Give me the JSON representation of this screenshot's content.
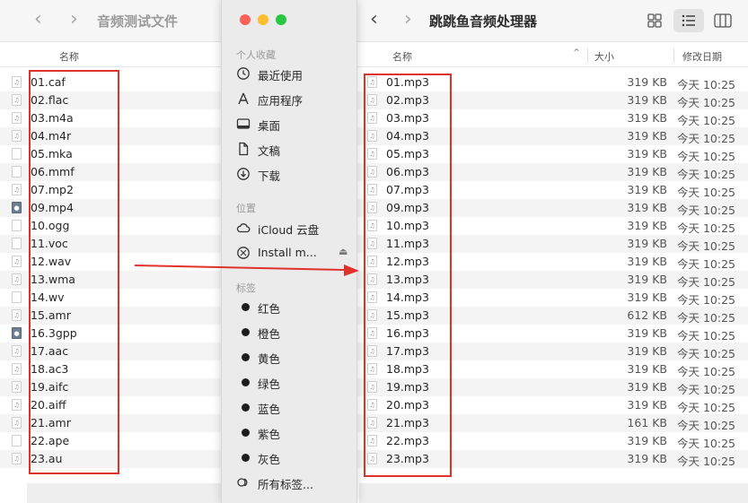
{
  "left_window": {
    "title": "音频测试文件",
    "column_name": "名称",
    "files": [
      {
        "name": "01.caf",
        "icon": "audio-file-icon"
      },
      {
        "name": "02.flac",
        "icon": "audio-file-icon"
      },
      {
        "name": "03.m4a",
        "icon": "audio-file-icon"
      },
      {
        "name": "04.m4r",
        "icon": "audio-file-icon"
      },
      {
        "name": "05.mka",
        "icon": "blank-file-icon"
      },
      {
        "name": "06.mmf",
        "icon": "blank-file-icon"
      },
      {
        "name": "07.mp2",
        "icon": "audio-file-icon"
      },
      {
        "name": "09.mp4",
        "icon": "video-file-icon"
      },
      {
        "name": "10.ogg",
        "icon": "blank-file-icon"
      },
      {
        "name": "11.voc",
        "icon": "blank-file-icon"
      },
      {
        "name": "12.wav",
        "icon": "audio-file-icon"
      },
      {
        "name": "13.wma",
        "icon": "audio-file-icon"
      },
      {
        "name": "14.wv",
        "icon": "blank-file-icon"
      },
      {
        "name": "15.amr",
        "icon": "audio-file-icon"
      },
      {
        "name": "16.3gpp",
        "icon": "video-file-icon"
      },
      {
        "name": "17.aac",
        "icon": "audio-file-icon"
      },
      {
        "name": "18.ac3",
        "icon": "audio-file-icon"
      },
      {
        "name": "19.aifc",
        "icon": "audio-file-icon"
      },
      {
        "name": "20.aiff",
        "icon": "audio-file-icon"
      },
      {
        "name": "21.amr",
        "icon": "audio-file-icon"
      },
      {
        "name": "22.ape",
        "icon": "blank-file-icon"
      },
      {
        "name": "23.au",
        "icon": "audio-file-icon"
      }
    ]
  },
  "sidebar": {
    "favorites_label": "个人收藏",
    "favorites": [
      {
        "label": "最近使用",
        "icon": "clock-icon"
      },
      {
        "label": "应用程序",
        "icon": "applications-icon"
      },
      {
        "label": "桌面",
        "icon": "desktop-icon"
      },
      {
        "label": "文稿",
        "icon": "document-icon"
      },
      {
        "label": "下载",
        "icon": "download-icon"
      }
    ],
    "locations_label": "位置",
    "locations": [
      {
        "label": "iCloud 云盘",
        "icon": "cloud-icon"
      },
      {
        "label": "Install m...",
        "icon": "disk-icon",
        "eject": "eject-icon"
      }
    ],
    "tags_label": "标签",
    "tags": [
      {
        "label": "红色"
      },
      {
        "label": "橙色"
      },
      {
        "label": "黄色"
      },
      {
        "label": "绿色"
      },
      {
        "label": "蓝色"
      },
      {
        "label": "紫色"
      },
      {
        "label": "灰色"
      }
    ],
    "all_tags": {
      "label": "所有标签...",
      "icon": "tags-icon"
    }
  },
  "right_window": {
    "title": "跳跳鱼音频处理器",
    "columns": {
      "name": "名称",
      "size": "大小",
      "date": "修改日期"
    },
    "files": [
      {
        "name": "01.mp3",
        "size": "319 KB",
        "date": "今天 10:25"
      },
      {
        "name": "02.mp3",
        "size": "319 KB",
        "date": "今天 10:25"
      },
      {
        "name": "03.mp3",
        "size": "319 KB",
        "date": "今天 10:25"
      },
      {
        "name": "04.mp3",
        "size": "319 KB",
        "date": "今天 10:25"
      },
      {
        "name": "05.mp3",
        "size": "319 KB",
        "date": "今天 10:25"
      },
      {
        "name": "06.mp3",
        "size": "319 KB",
        "date": "今天 10:25"
      },
      {
        "name": "07.mp3",
        "size": "319 KB",
        "date": "今天 10:25"
      },
      {
        "name": "09.mp3",
        "size": "319 KB",
        "date": "今天 10:25"
      },
      {
        "name": "10.mp3",
        "size": "319 KB",
        "date": "今天 10:25"
      },
      {
        "name": "11.mp3",
        "size": "319 KB",
        "date": "今天 10:25"
      },
      {
        "name": "12.mp3",
        "size": "319 KB",
        "date": "今天 10:25"
      },
      {
        "name": "13.mp3",
        "size": "319 KB",
        "date": "今天 10:25"
      },
      {
        "name": "14.mp3",
        "size": "319 KB",
        "date": "今天 10:25"
      },
      {
        "name": "15.mp3",
        "size": "612 KB",
        "date": "今天 10:25"
      },
      {
        "name": "16.mp3",
        "size": "319 KB",
        "date": "今天 10:25"
      },
      {
        "name": "17.mp3",
        "size": "319 KB",
        "date": "今天 10:25"
      },
      {
        "name": "18.mp3",
        "size": "319 KB",
        "date": "今天 10:25"
      },
      {
        "name": "19.mp3",
        "size": "319 KB",
        "date": "今天 10:25"
      },
      {
        "name": "20.mp3",
        "size": "319 KB",
        "date": "今天 10:25"
      },
      {
        "name": "21.mp3",
        "size": "161 KB",
        "date": "今天 10:25"
      },
      {
        "name": "22.mp3",
        "size": "319 KB",
        "date": "今天 10:25"
      },
      {
        "name": "23.mp3",
        "size": "319 KB",
        "date": "今天 10:25"
      }
    ]
  },
  "colors": {
    "highlight_box": "#e0322b",
    "arrow": "#e0322b",
    "traffic_close": "#fe5f57",
    "traffic_minimize": "#febc2e",
    "traffic_zoom": "#28c840"
  }
}
